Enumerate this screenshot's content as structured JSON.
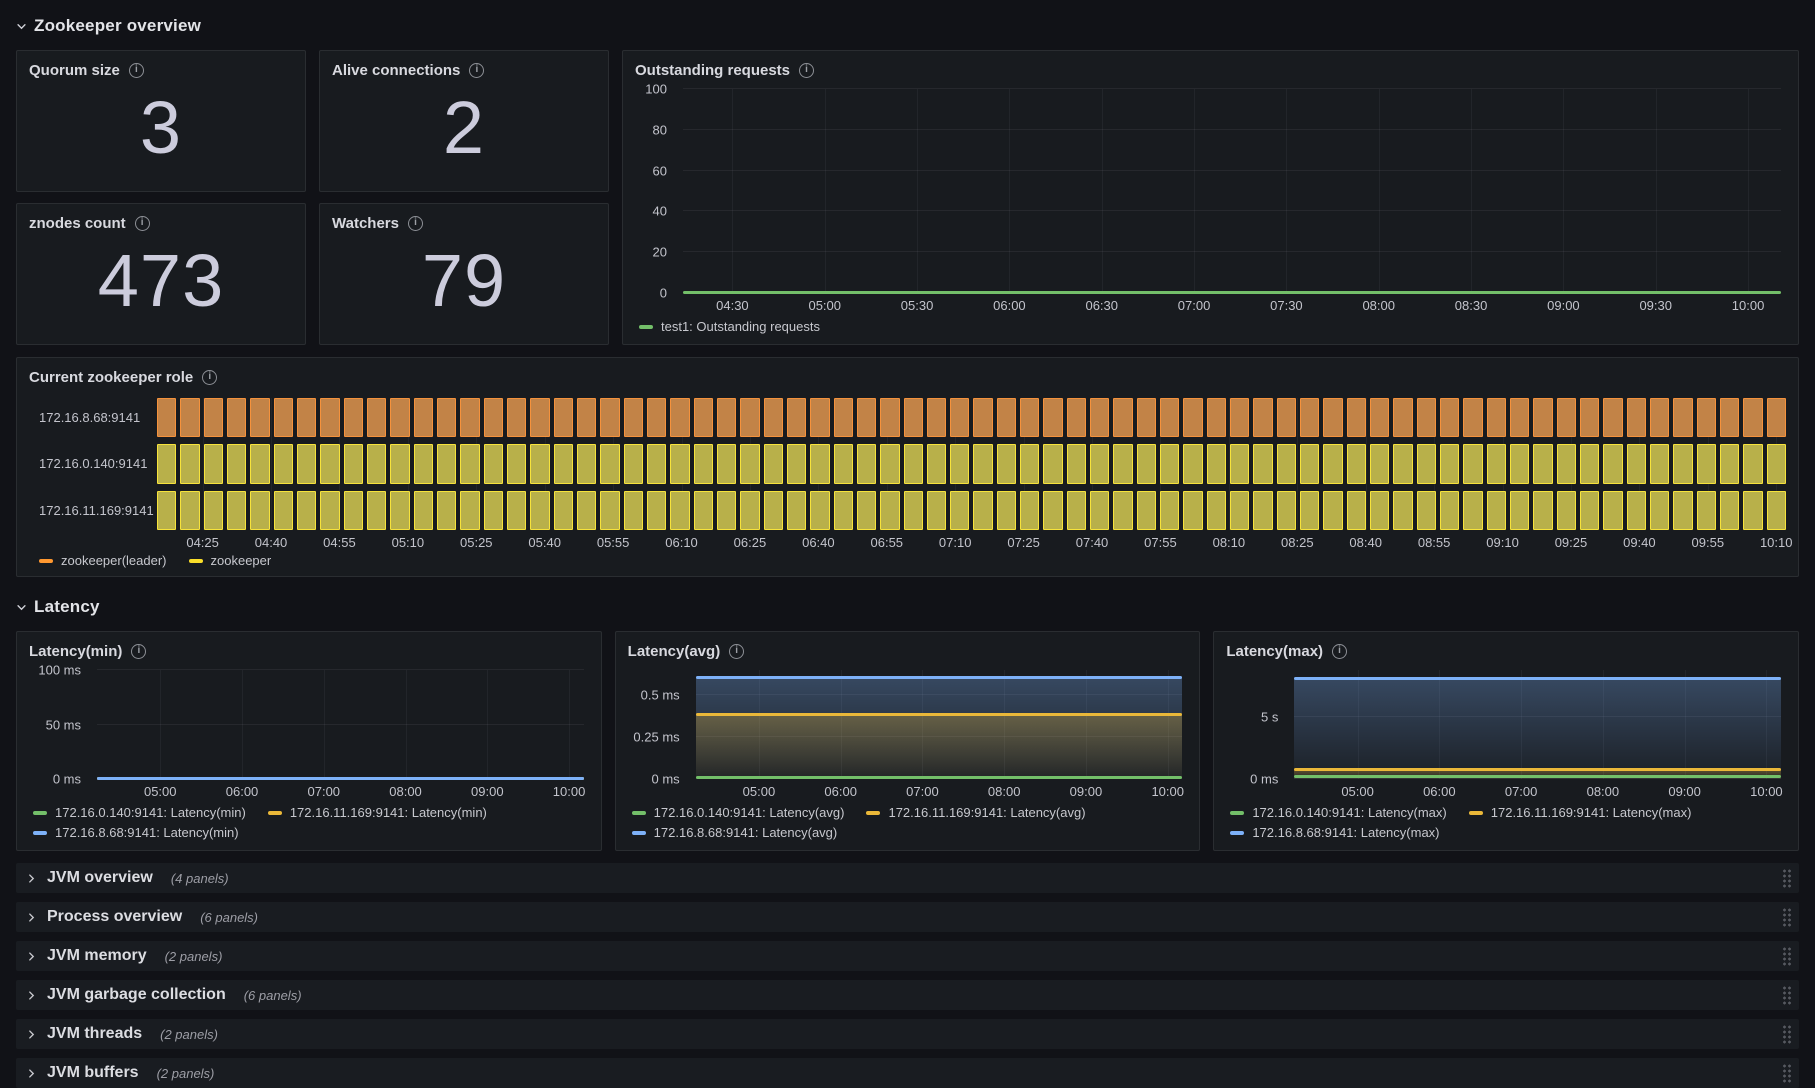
{
  "sections": {
    "overview": {
      "title": "Zookeeper overview"
    },
    "latency": {
      "title": "Latency"
    }
  },
  "stat_panels": [
    {
      "title": "Quorum size",
      "value": "3"
    },
    {
      "title": "Alive connections",
      "value": "2"
    },
    {
      "title": "znodes count",
      "value": "473"
    },
    {
      "title": "Watchers",
      "value": "79"
    }
  ],
  "panel_titles": {
    "outstanding_requests": "Outstanding requests",
    "zookeeper_role": "Current zookeeper role",
    "latency_min": "Latency(min)",
    "latency_avg": "Latency(avg)",
    "latency_max": "Latency(max)"
  },
  "collapsed_rows": [
    {
      "title": "JVM overview",
      "count": "(4 panels)"
    },
    {
      "title": "Process overview",
      "count": "(6 panels)"
    },
    {
      "title": "JVM memory",
      "count": "(2 panels)"
    },
    {
      "title": "JVM garbage collection",
      "count": "(6 panels)"
    },
    {
      "title": "JVM threads",
      "count": "(2 panels)"
    },
    {
      "title": "JVM buffers",
      "count": "(2 panels)"
    }
  ],
  "chart_data": [
    {
      "id": "outstanding_requests",
      "type": "line",
      "title": "Outstanding requests",
      "ylim": [
        0,
        100
      ],
      "grid": true,
      "legend_position": "bottom",
      "y_ticks": [
        {
          "label": "0",
          "value": 0
        },
        {
          "label": "20",
          "value": 20
        },
        {
          "label": "40",
          "value": 40
        },
        {
          "label": "60",
          "value": 60
        },
        {
          "label": "80",
          "value": 80
        },
        {
          "label": "100",
          "value": 100
        }
      ],
      "x_ticks": [
        "04:30",
        "05:00",
        "05:30",
        "06:00",
        "06:30",
        "07:00",
        "07:30",
        "08:00",
        "08:30",
        "09:00",
        "09:30",
        "10:00"
      ],
      "series": [
        {
          "name": "test1: Outstanding requests",
          "color": "#73bf69",
          "value": 0,
          "fill": false
        }
      ]
    },
    {
      "id": "zookeeper_role",
      "type": "state-timeline",
      "title": "Current zookeeper role",
      "rows": [
        {
          "label": "172.16.8.68:9141",
          "state": "zookeeper(leader)"
        },
        {
          "label": "172.16.0.140:9141",
          "state": "zookeeper"
        },
        {
          "label": "172.16.11.169:9141",
          "state": "zookeeper"
        }
      ],
      "states": {
        "zookeeper(leader)": {
          "border": "#f5923c",
          "fill": "#c28347"
        },
        "zookeeper": {
          "border": "#f7e33b",
          "fill": "#b8b04a"
        }
      },
      "blocks_per_row": 70,
      "x_ticks": [
        "04:25",
        "04:40",
        "04:55",
        "05:10",
        "05:25",
        "05:40",
        "05:55",
        "06:10",
        "06:25",
        "06:40",
        "06:55",
        "07:10",
        "07:25",
        "07:40",
        "07:55",
        "08:10",
        "08:25",
        "08:40",
        "08:55",
        "09:10",
        "09:25",
        "09:40",
        "09:55",
        "10:10"
      ],
      "legend": [
        {
          "label": "zookeeper(leader)",
          "color": "#ff9830"
        },
        {
          "label": "zookeeper",
          "color": "#fade2a"
        }
      ]
    },
    {
      "id": "latency_min",
      "type": "line",
      "title": "Latency(min)",
      "ylim": [
        0,
        100
      ],
      "grid": true,
      "legend_position": "bottom",
      "y_ticks": [
        {
          "label": "0 ms",
          "value": 0
        },
        {
          "label": "50 ms",
          "value": 50
        },
        {
          "label": "100 ms",
          "value": 100
        }
      ],
      "x_ticks": [
        "05:00",
        "06:00",
        "07:00",
        "08:00",
        "09:00",
        "10:00"
      ],
      "series": [
        {
          "name": "172.16.0.140:9141: Latency(min)",
          "color": "#73bf69",
          "value": 0,
          "fill": false
        },
        {
          "name": "172.16.11.169:9141: Latency(min)",
          "color": "#eab839",
          "value": 0,
          "fill": false
        },
        {
          "name": "172.16.8.68:9141: Latency(min)",
          "color": "#7db1f8",
          "value": 0,
          "fill": false
        }
      ]
    },
    {
      "id": "latency_avg",
      "type": "area",
      "title": "Latency(avg)",
      "ylim": [
        0,
        0.65
      ],
      "grid": true,
      "legend_position": "bottom",
      "y_ticks": [
        {
          "label": "0 ms",
          "value": 0
        },
        {
          "label": "0.25 ms",
          "value": 0.25
        },
        {
          "label": "0.5 ms",
          "value": 0.5
        }
      ],
      "x_ticks": [
        "05:00",
        "06:00",
        "07:00",
        "08:00",
        "09:00",
        "10:00"
      ],
      "series": [
        {
          "name": "172.16.0.140:9141: Latency(avg)",
          "color": "#73bf69",
          "value": 0.004,
          "fill": false
        },
        {
          "name": "172.16.11.169:9141: Latency(avg)",
          "color": "#eab839",
          "value": 0.38,
          "fill": true
        },
        {
          "name": "172.16.8.68:9141: Latency(avg)",
          "color": "#7db1f8",
          "value": 0.6,
          "fill": true
        }
      ]
    },
    {
      "id": "latency_max",
      "type": "area",
      "title": "Latency(max)",
      "ylim": [
        0,
        8.8
      ],
      "grid": true,
      "legend_position": "bottom",
      "y_ticks": [
        {
          "label": "0 ms",
          "value": 0
        },
        {
          "label": "5 s",
          "value": 5
        }
      ],
      "x_ticks": [
        "05:00",
        "06:00",
        "07:00",
        "08:00",
        "09:00",
        "10:00"
      ],
      "series": [
        {
          "name": "172.16.0.140:9141: Latency(max)",
          "color": "#73bf69",
          "value": 0.18,
          "fill": false
        },
        {
          "name": "172.16.11.169:9141: Latency(max)",
          "color": "#eab839",
          "value": 0.75,
          "fill": true
        },
        {
          "name": "172.16.8.68:9141: Latency(max)",
          "color": "#7db1f8",
          "value": 8.1,
          "fill": true
        }
      ]
    }
  ]
}
